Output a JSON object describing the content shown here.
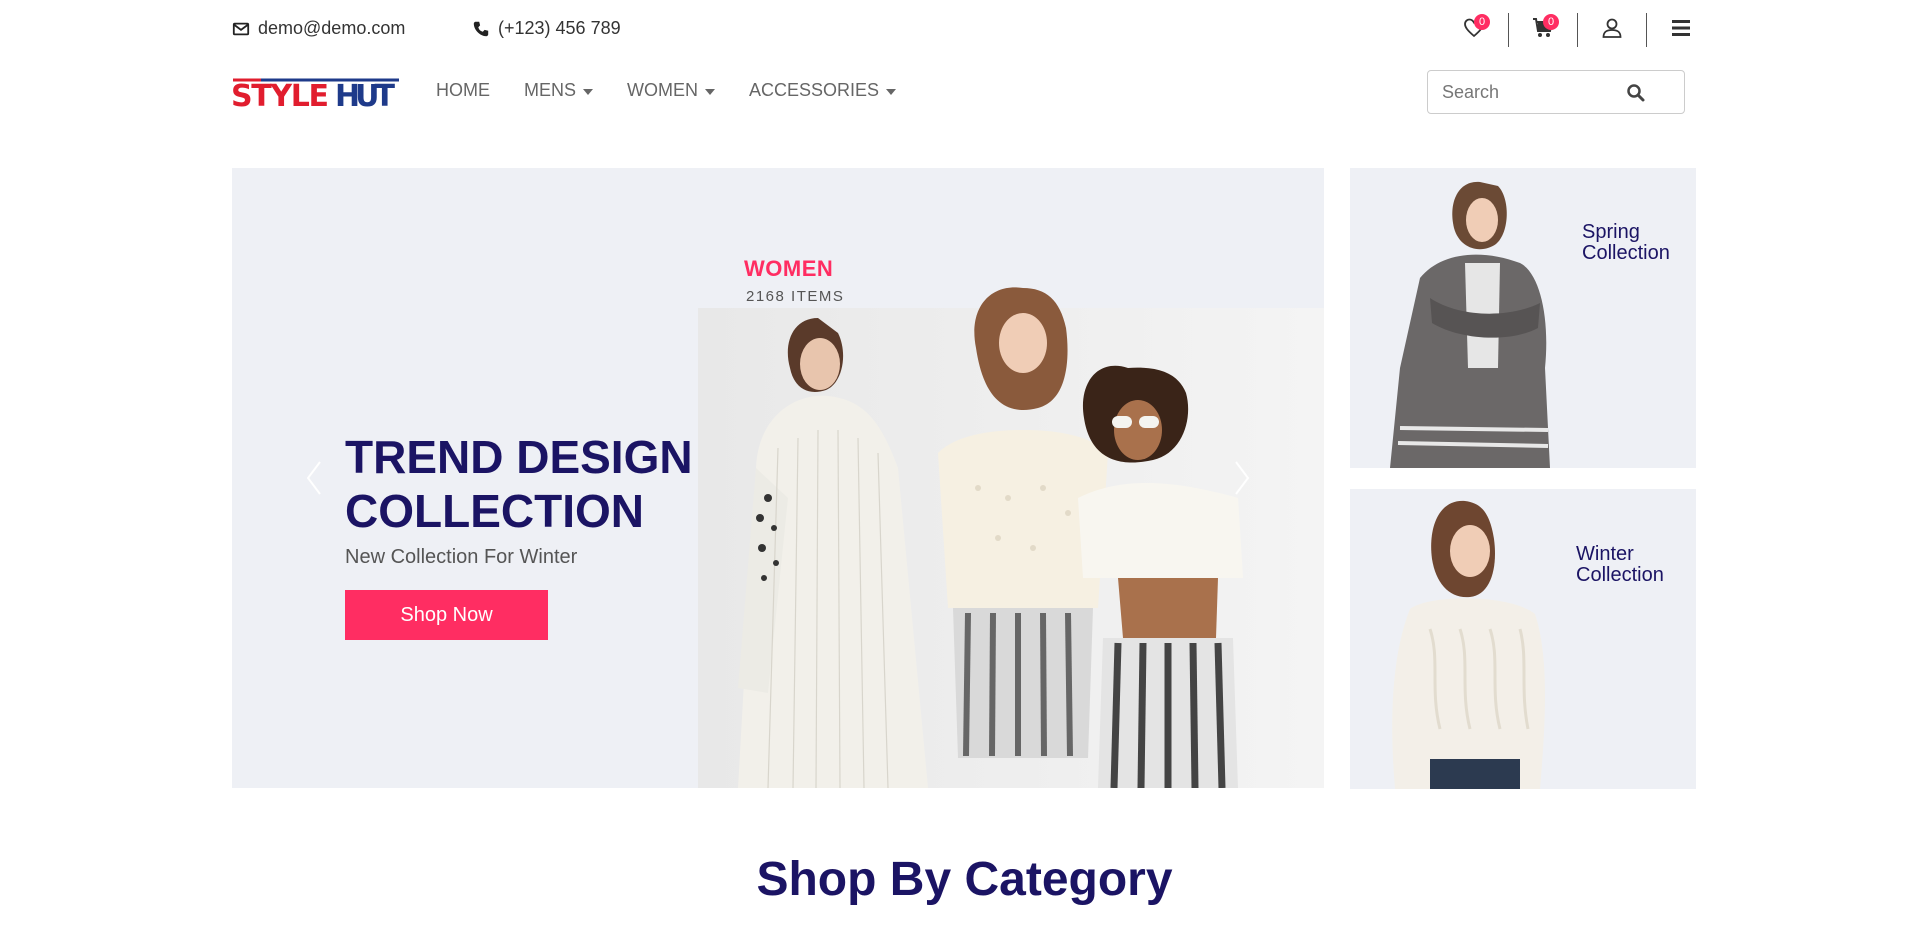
{
  "topbar": {
    "email": "demo@demo.com",
    "phone": "(+123) 456 789",
    "wishlist_count": "0",
    "cart_count": "0"
  },
  "brand": {
    "logo_text": "STYLE HUT",
    "colors": {
      "primary": "#1b1464",
      "accent": "#ff2d62",
      "logo_blue": "#1e3a8a",
      "logo_red": "#e11d2e"
    }
  },
  "nav": {
    "items": [
      {
        "label": "HOME",
        "dropdown": false
      },
      {
        "label": "MENS",
        "dropdown": true
      },
      {
        "label": "WOMEN",
        "dropdown": true
      },
      {
        "label": "ACCESSORIES",
        "dropdown": true
      }
    ],
    "search_placeholder": "Search"
  },
  "hero": {
    "title_line1": "TREND DESIGN",
    "title_line2": "COLLECTION",
    "subtitle": "New Collection For Winter",
    "button": "Shop Now",
    "category_label": "WOMEN",
    "category_count": "2168 ITEMS"
  },
  "banners": [
    {
      "line1": "Spring",
      "line2": "Collection"
    },
    {
      "line1": "Winter",
      "line2": "Collection"
    }
  ],
  "section": {
    "title": "Shop By Category"
  },
  "icons": [
    "envelope-icon",
    "phone-icon",
    "heart-icon",
    "cart-icon",
    "user-icon",
    "menu-icon",
    "search-icon",
    "chevron-left-icon",
    "chevron-right-icon"
  ]
}
